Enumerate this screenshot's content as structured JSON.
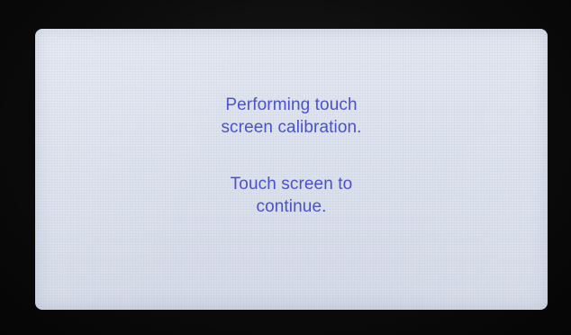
{
  "screen": {
    "background_color": "#dde2ed",
    "text_color": "#4a52c9",
    "calibration_message": {
      "line1": "Performing touch",
      "line2": "screen calibration."
    },
    "continue_message": {
      "line1": "Touch screen to",
      "line2": "continue."
    }
  }
}
